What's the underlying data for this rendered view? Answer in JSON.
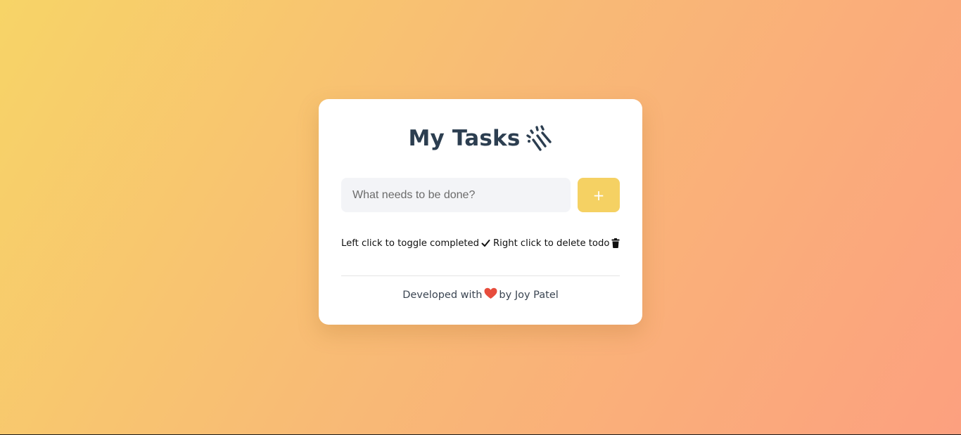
{
  "header": {
    "title": "My Tasks",
    "title_icon": "sparkle-icon"
  },
  "task_form": {
    "placeholder": "What needs to be done?",
    "value": "",
    "add_label": "+"
  },
  "hints": {
    "toggle_text": "Left click to toggle completed",
    "toggle_icon": "check-icon",
    "delete_text": "Right click to delete todo",
    "delete_icon": "trash-icon"
  },
  "footer": {
    "prefix": "Developed with",
    "heart_icon": "heart-icon",
    "suffix": "by Joy Patel"
  },
  "colors": {
    "accent": "#f5d163",
    "title": "#2c3e50",
    "heart": "#e74c3c",
    "gradient_start": "#f7d467",
    "gradient_end": "#fca07f"
  }
}
